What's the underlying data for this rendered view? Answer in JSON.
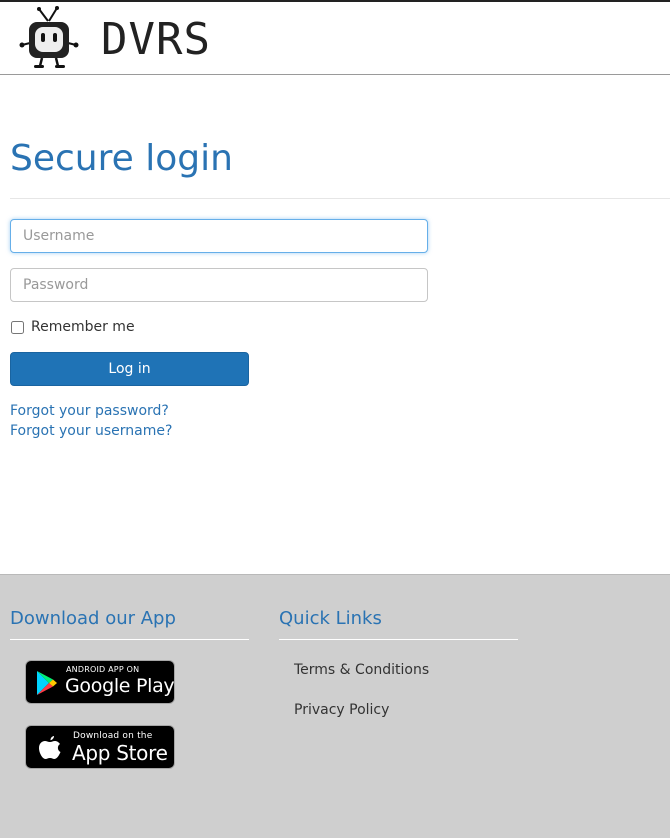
{
  "header": {
    "logo_text": "DVRS"
  },
  "login": {
    "title": "Secure login",
    "username_placeholder": "Username",
    "password_placeholder": "Password",
    "remember_label": "Remember me",
    "remember_checked": false,
    "login_button": "Log in",
    "forgot_password": "Forgot your password?",
    "forgot_username": "Forgot your username?"
  },
  "footer": {
    "app_heading": "Download our App",
    "links_heading": "Quick Links",
    "google_badge": {
      "small": "ANDROID APP ON",
      "big": "Google Play"
    },
    "apple_badge": {
      "small": "Download on the",
      "big": "App Store"
    },
    "quick_links": [
      "Terms & Conditions",
      "Privacy Policy"
    ]
  },
  "colors": {
    "accent": "#2a73b3",
    "button": "#1f73b6",
    "footer_bg": "#cfcfcf"
  },
  "icons": {
    "logo": "tv-mascot-icon",
    "google": "google-play-icon",
    "apple": "apple-icon"
  }
}
